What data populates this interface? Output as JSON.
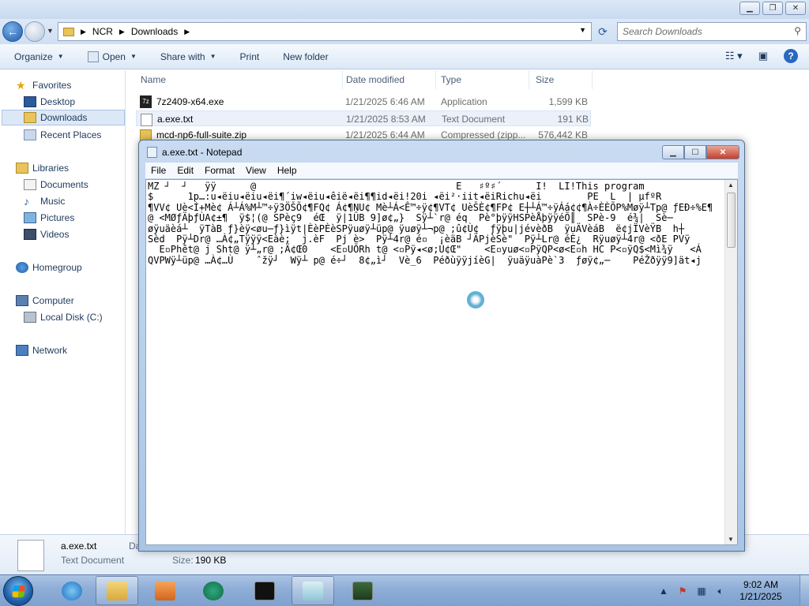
{
  "explorer": {
    "breadcrumb": [
      "NCR",
      "Downloads"
    ],
    "search_placeholder": "Search Downloads",
    "toolbar": {
      "organize": "Organize",
      "open": "Open",
      "share_with": "Share with",
      "print": "Print",
      "new_folder": "New folder"
    },
    "sidebar": {
      "favorites": "Favorites",
      "desktop": "Desktop",
      "downloads": "Downloads",
      "recent_places": "Recent Places",
      "libraries": "Libraries",
      "documents": "Documents",
      "music": "Music",
      "pictures": "Pictures",
      "videos": "Videos",
      "homegroup": "Homegroup",
      "computer": "Computer",
      "local_disk": "Local Disk (C:)",
      "network": "Network"
    },
    "columns": {
      "name": "Name",
      "date_modified": "Date modified",
      "type": "Type",
      "size": "Size"
    },
    "files": [
      {
        "name": "7z2409-x64.exe",
        "date": "1/21/2025 6:46 AM",
        "type": "Application",
        "size": "1,599 KB"
      },
      {
        "name": "a.exe.txt",
        "date": "1/21/2025 8:53 AM",
        "type": "Text Document",
        "size": "191 KB"
      },
      {
        "name": "mcd-np6-full-suite.zip",
        "date": "1/21/2025 6:44 AM",
        "type": "Compressed (zipp...",
        "size": "576,442 KB"
      }
    ],
    "details": {
      "name": "a.exe.txt",
      "type": "Text Document",
      "cut_label": "Da",
      "size_label": "Size:",
      "size_value": "190 KB"
    }
  },
  "notepad": {
    "title": "a.exe.txt - Notepad",
    "menu": [
      "File",
      "Edit",
      "Format",
      "View",
      "Help"
    ],
    "content": "MZ ┘  ┘   ÿÿ      @                                   È   ♯º♯´      Í!  LÍ!This program\n$      1p…:u◂ëiu◂ëiu◂ëi¶´iw◂ëiu◂êië◂ëi¶¶id◂ëi!20i ◂ëi²·iit◂ëiRichu◂ëi        PE  L  | µfºR\n¶VV¢ Uè<Ì+Mè¢ Á┴Á%M┴™÷ÿ3ÖŠÕ¢¶FQ¢ Á¢¶NU¢ Mè┴Á<Ê™÷ÿ¢¶VT¢ UèŠÈ¢¶FP¢ E┼┴Á™÷ÿÁá¢¢¶À÷ÈÈÕP%Møÿ┴Tp@ ƒEÐ÷%E¶\n@ <MØƒÄþƒÙA¢±¶  ÿ$¦(@ SPèç9  éŒ  ÿ|1ÛB 9]ø¢„}  Sÿ┴`r@ éq  Pè°þÿÿHSPèÅþÿÿéÕ║  SPè-9  é¾|  Sè─\nøÿuäèá┴  ÿTàB ƒ}èÿ<øu─ƒ}ìÿt|ÈèPÈèSPÿuøÿ┴üp@ ÿuøÿ┴¬p@ ;û¢Ù¢  ƒÿþu|jévèðB  ÿuÄVèáB  ë¢jÏVèŸB  h┼\nSèd  Pÿ┴Dr@ …À¢„Tÿÿÿ<Eàè;  j.èF  Pj è>  Pÿ┴4r@ é▫  ¡èäB ┘ÄPjèSè\"  Pÿ┴Lr@ éÈ¿  Rÿuøÿ┴4r@ <ðE PVÿ\n  E▫Phêt@ j Sht@ ÿ┴„r@ ;Ä¢Œ0    <E▫UÕRh t@ <▫Pÿ◂<ø;Ù¢Œ\"    <E▫yuø<▫PÿQP<ø<E▫h HC P<▫ÿQ$<Mì¾ÿ   <Á\nQVPWÿ┴üp@ …À¢…Ù    ˆžÿ┘  Wÿ┴ p@ é÷┘  8¢„ì┘  Vè_6  PéðùÿÿjíèG|  ÿuäÿuàPè`3  ƒøÿ¢„─    PéŽðÿÿ9]ät◂j"
  },
  "taskbar": {
    "time": "9:02 AM",
    "date": "1/21/2025"
  }
}
